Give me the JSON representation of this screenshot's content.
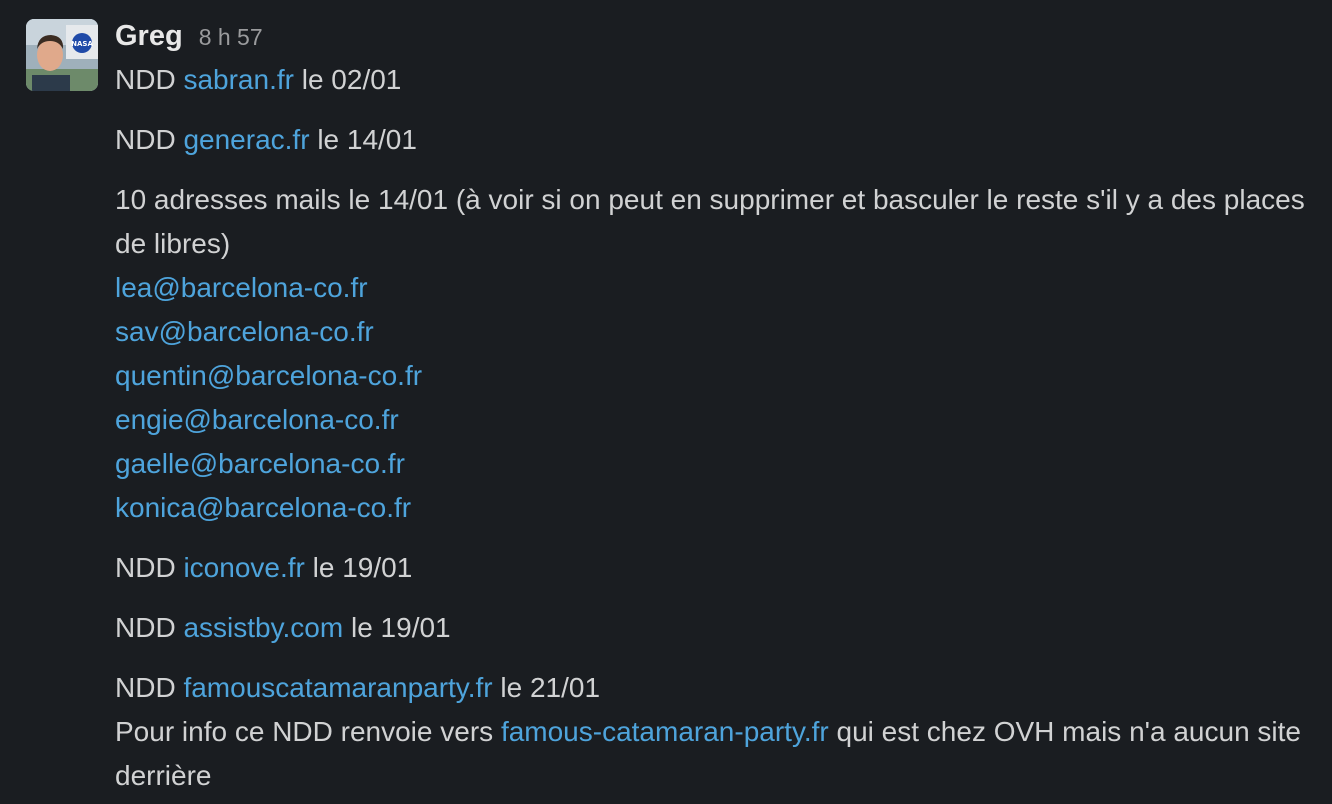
{
  "message": {
    "author": "Greg",
    "timestamp": "8 h 57",
    "avatar": "avatar-photo",
    "colors": {
      "background": "#1a1d21",
      "text": "#d1d2d3",
      "link": "#4ea4dc",
      "muted": "#9a9b9d"
    },
    "p1": {
      "prefix": "NDD",
      "link": "sabran.fr",
      "suffix": "le 02/01"
    },
    "p2": {
      "prefix": "NDD",
      "link": "generac.fr",
      "suffix": "le 14/01"
    },
    "p3": {
      "text": "10 adresses mails le 14/01 (à voir si on peut en supprimer et basculer le reste s'il y a des places de libres)",
      "emails": [
        "lea@barcelona-co.fr",
        "sav@barcelona-co.fr",
        "quentin@barcelona-co.fr",
        "engie@barcelona-co.fr",
        "gaelle@barcelona-co.fr",
        "konica@barcelona-co.fr"
      ]
    },
    "p4": {
      "prefix": "NDD",
      "link": "iconove.fr",
      "suffix": "le 19/01"
    },
    "p5": {
      "prefix": "NDD",
      "link": "assistby.com",
      "suffix": "le 19/01"
    },
    "p6": {
      "prefix": "NDD",
      "link": "famouscatamaranparty.fr",
      "suffix": "le 21/01",
      "note_prefix": "Pour info ce NDD renvoie vers",
      "note_link": "famous-catamaran-party.fr",
      "note_suffix": "qui est chez OVH mais n'a aucun site derrière"
    }
  }
}
